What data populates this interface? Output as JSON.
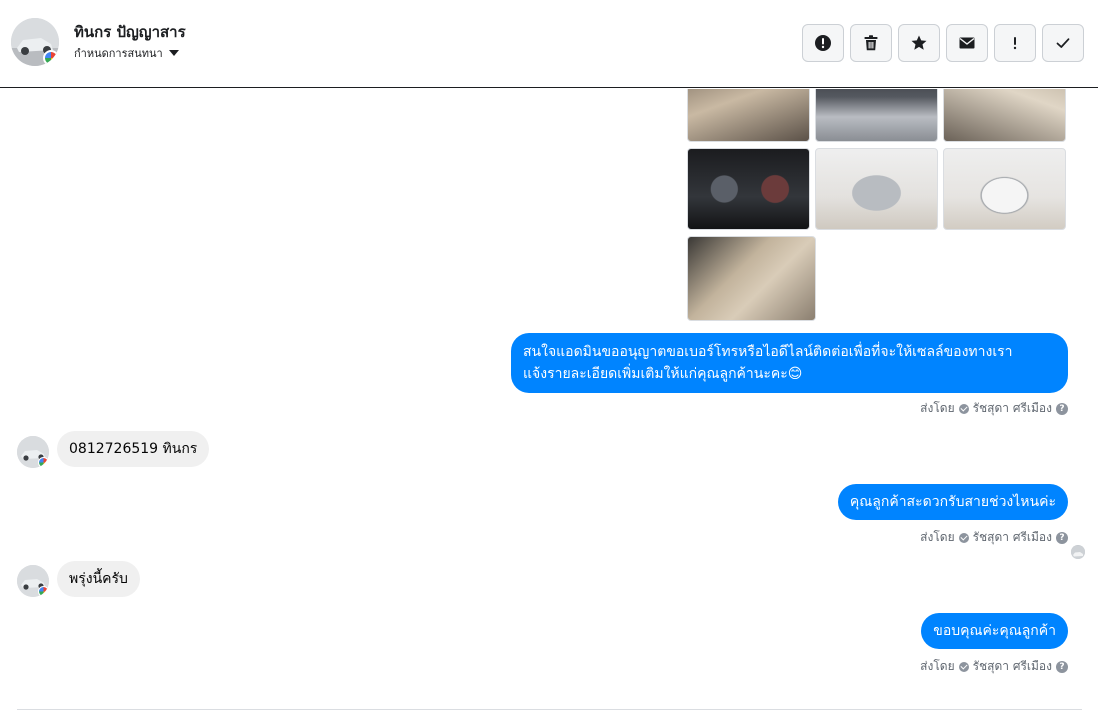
{
  "header": {
    "contact_name": "ทินกร ปัญญาสาร",
    "assign_label": "กำหนดการสนทนา",
    "actions": [
      {
        "icon": "alert-circle-icon"
      },
      {
        "icon": "trash-icon"
      },
      {
        "icon": "star-icon"
      },
      {
        "icon": "envelope-icon"
      },
      {
        "icon": "exclamation-icon"
      },
      {
        "icon": "check-icon"
      }
    ]
  },
  "messages": {
    "m1_text_line1": "สนใจแอดมินขออนุญาตขอเบอร์โทรหรือไอดีไลน์ติดต่อเพื่อที่จะให้เซลล์ของทางเรา",
    "m1_text_line2": "แจ้งรายละเอียดเพิ่มเติมให้แก่คุณลูกค้านะคะ😊",
    "m2_text": "0812726519  ทินกร",
    "m3_text": "คุณลูกค้าสะดวกรับสายช่วงไหนค่ะ",
    "m4_text": "พรุ่งนี้ครับ",
    "m5_text": "ขอบคุณค่ะคุณลูกค้า"
  },
  "sent_meta": {
    "prefix": "ส่งโดย",
    "sender": "รัชสุดา ศรีเมือง",
    "help": "?"
  },
  "colors": {
    "outgoing_bubble": "#0084ff",
    "incoming_bubble": "#f0f0f0"
  }
}
